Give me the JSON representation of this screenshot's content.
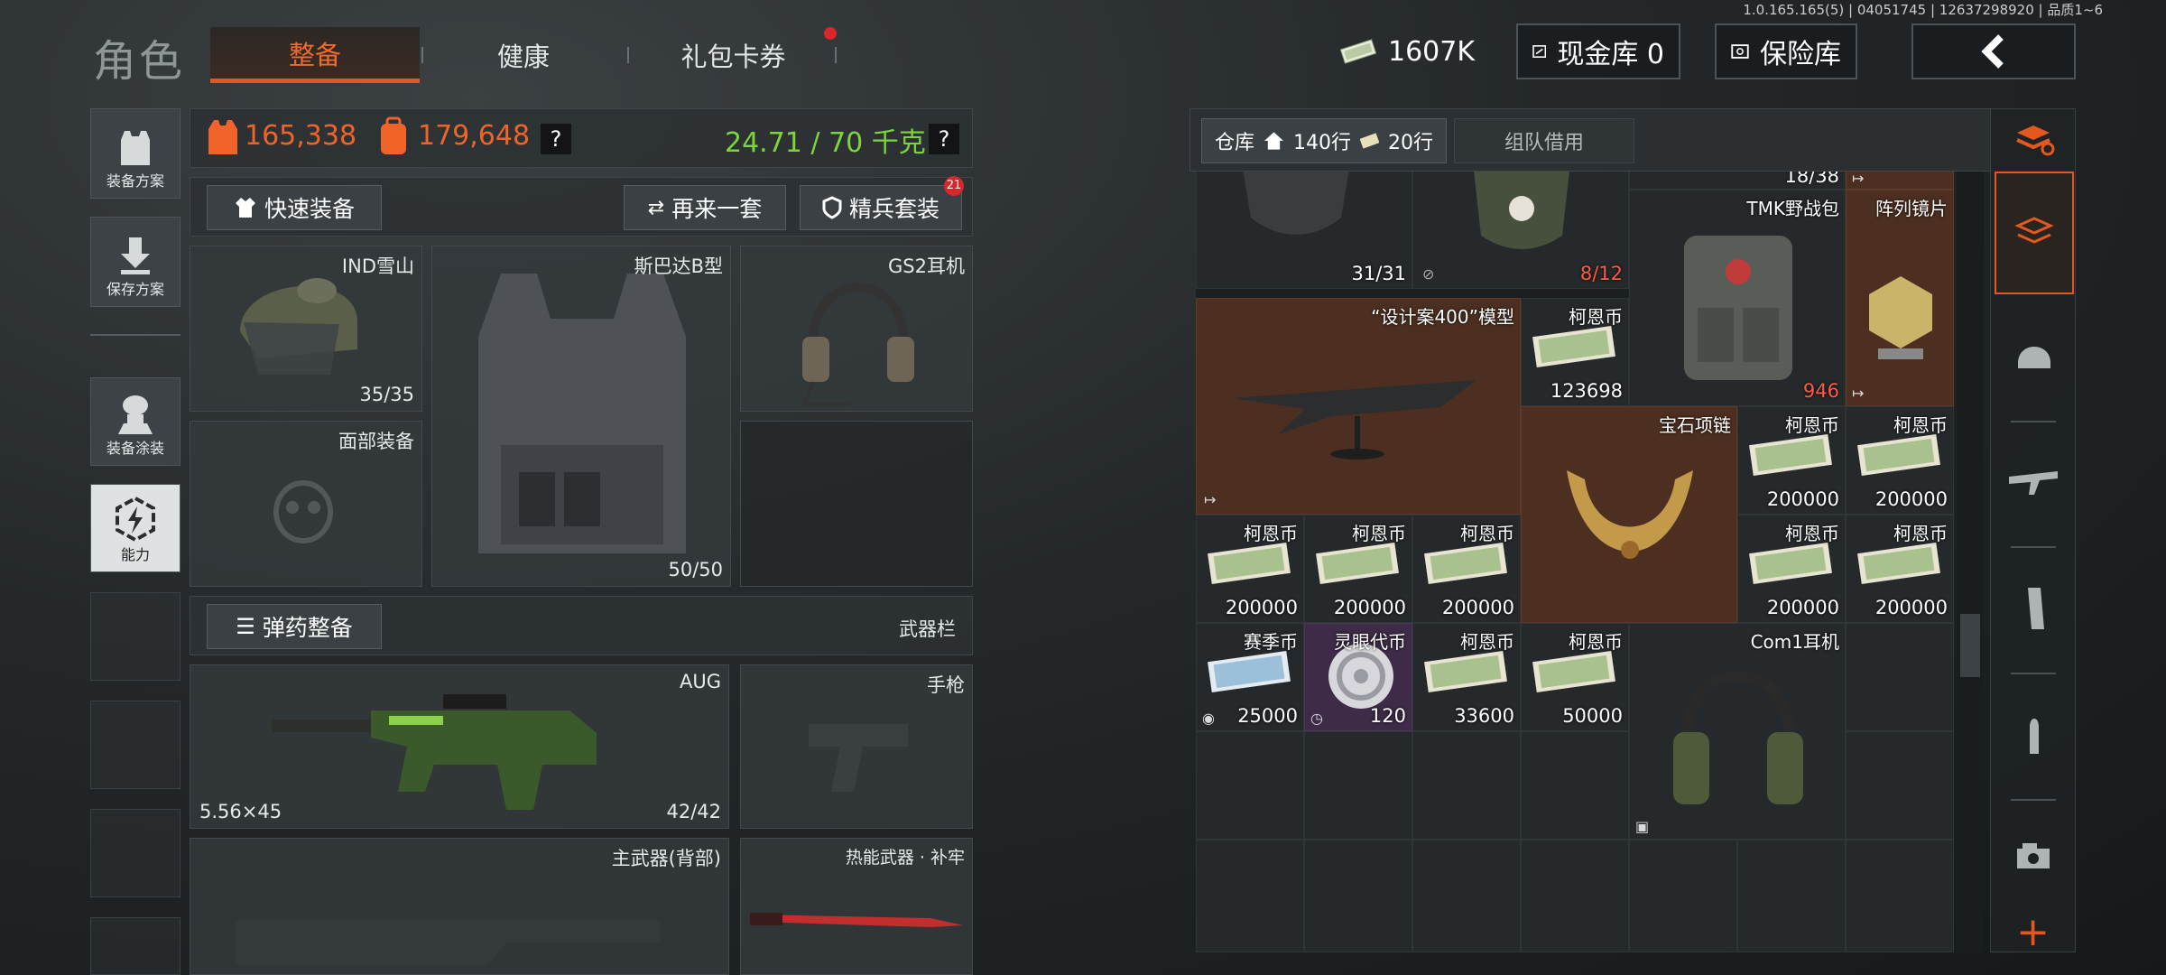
{
  "build_info": "1.0.165.165(5) | 04051745 | 12637298920 | 品质1~6",
  "header": {
    "title": "角色",
    "tabs": [
      {
        "label": "整备"
      },
      {
        "label": "健康"
      },
      {
        "label": "礼包卡券"
      }
    ],
    "money": "1607K",
    "cash_box": "现金库 0",
    "safe": "保险库"
  },
  "side_nav": [
    {
      "label": "装备方案"
    },
    {
      "label": "保存方案"
    },
    {
      "label": "装备涂装"
    },
    {
      "label": "能力"
    }
  ],
  "loadout": {
    "value_armor": "165,338",
    "value_bag": "179,648",
    "weight": "24.71 / 70 千克",
    "quick_equip": "快速装备",
    "again": "再来一套",
    "elite": "精兵套装",
    "elite_badge": "21",
    "helmet": {
      "name": "IND雪山",
      "durability": "35/35"
    },
    "armor": {
      "name": "斯巴达B型",
      "durability": "50/50"
    },
    "headset": {
      "name": "GS2耳机"
    },
    "face": {
      "name": "面部装备"
    },
    "ammo_btn": "弹药整备",
    "weapon_bar": "武器栏",
    "weapon": {
      "name": "AUG",
      "caliber": "5.56×45",
      "ammo": "42/42"
    },
    "pistol": "手枪",
    "primary_back": "主武器(背部)",
    "melee": "热能武器 · 补牢"
  },
  "storage": {
    "tab_warehouse": "仓库",
    "rows": "140行",
    "tickets": "20行",
    "team_borrow": "组队借用",
    "items": [
      {
        "id": "helmet2",
        "name": "",
        "value": "31/31"
      },
      {
        "id": "medbag",
        "name": "",
        "value": "8/12"
      },
      {
        "id": "top",
        "name": "",
        "value": "18/38"
      },
      {
        "id": "tmk",
        "name": "TMK野战包",
        "value": "946"
      },
      {
        "id": "lens",
        "name": "阵列镜片",
        "value": ""
      },
      {
        "id": "model",
        "name": "“设计案400”模型",
        "value": ""
      },
      {
        "id": "coin1",
        "name": "柯恩币",
        "value": "123698"
      },
      {
        "id": "necklace",
        "name": "宝石项链",
        "value": ""
      },
      {
        "id": "coin2",
        "name": "柯恩币",
        "value": "200000"
      },
      {
        "id": "coin3",
        "name": "柯恩币",
        "value": "200000"
      },
      {
        "id": "coin4",
        "name": "柯恩币",
        "value": "200000"
      },
      {
        "id": "coin5",
        "name": "柯恩币",
        "value": "200000"
      },
      {
        "id": "coin6",
        "name": "柯恩币",
        "value": "200000"
      },
      {
        "id": "coin7",
        "name": "柯恩币",
        "value": "200000"
      },
      {
        "id": "coin8",
        "name": "柯恩币",
        "value": "200000"
      },
      {
        "id": "season",
        "name": "赛季币",
        "value": "25000"
      },
      {
        "id": "spirit",
        "name": "灵眼代币",
        "value": "120"
      },
      {
        "id": "coin9",
        "name": "柯恩币",
        "value": "33600"
      },
      {
        "id": "coin10",
        "name": "柯恩币",
        "value": "50000"
      },
      {
        "id": "com1",
        "name": "Com1耳机",
        "value": ""
      }
    ]
  },
  "colors": {
    "accent": "#e2581f",
    "green": "#7cd63b",
    "red": "#ff5a42",
    "orange_cell": "#4c2f20"
  }
}
